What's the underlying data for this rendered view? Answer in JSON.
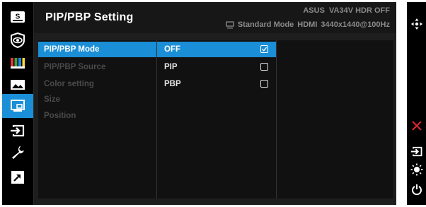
{
  "osd": {
    "title": "PIP/PBP Setting",
    "model_info": "ASUS  VA34V HDR OFF",
    "mode_label": "Standard Mode",
    "input_label": "HDMI",
    "resolution": "3440x1440@100Hz"
  },
  "sidebar": {
    "items": [
      {
        "icon": "splendid-s-icon",
        "active": false
      },
      {
        "icon": "eye-care-icon",
        "active": false
      },
      {
        "icon": "color-bars-icon",
        "active": false
      },
      {
        "icon": "image-icon",
        "active": false
      },
      {
        "icon": "pip-pbp-icon",
        "active": true
      },
      {
        "icon": "input-select-icon",
        "active": false
      },
      {
        "icon": "system-setup-wrench-icon",
        "active": false
      },
      {
        "icon": "shortcut-arrow-icon",
        "active": false
      }
    ]
  },
  "menu": {
    "items": [
      {
        "label": "PIP/PBP Mode",
        "active": true
      },
      {
        "label": "PIP/PBP Source",
        "active": false
      },
      {
        "label": "Color setting",
        "active": false
      },
      {
        "label": "Size",
        "active": false
      },
      {
        "label": "Position",
        "active": false
      }
    ]
  },
  "options": {
    "items": [
      {
        "label": "OFF",
        "checked": true,
        "active": true
      },
      {
        "label": "PIP",
        "checked": false,
        "active": false
      },
      {
        "label": "PBP",
        "checked": false,
        "active": false
      }
    ]
  },
  "right_keys": [
    {
      "icon": "five-way-navigation-icon",
      "color": "#ffffff"
    },
    {
      "icon": "close-x-icon",
      "color": "#d8262c"
    },
    {
      "icon": "input-select-icon",
      "color": "#ffffff"
    },
    {
      "icon": "brightness-icon",
      "color": "#ffffff"
    },
    {
      "icon": "power-icon",
      "color": "#ffffff"
    }
  ],
  "colors": {
    "accent": "#1a8ed6",
    "exit": "#d8262c",
    "text_dim": "#4a4a4a",
    "info_grey": "#8a8a8a"
  }
}
